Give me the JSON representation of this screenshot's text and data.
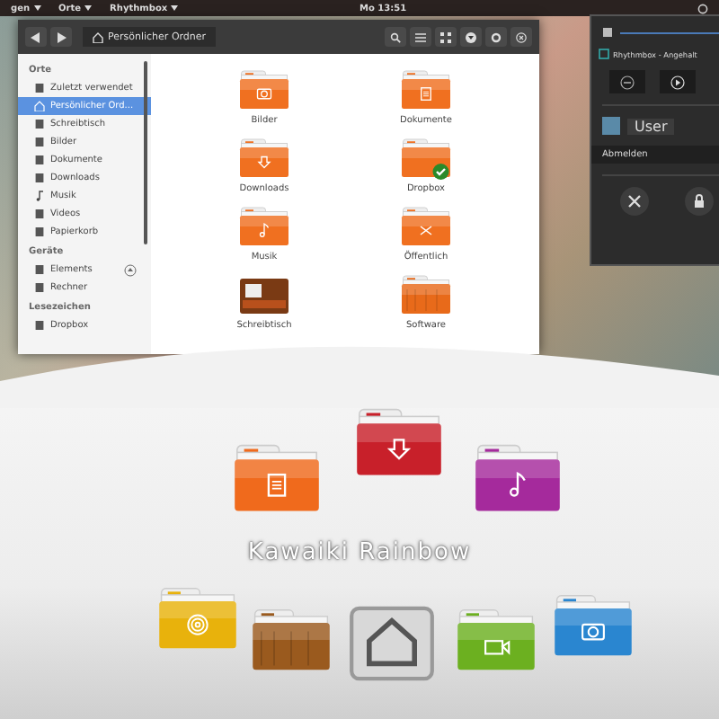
{
  "top_panel": {
    "menus": [
      "gen",
      "Orte",
      "Rhythmbox"
    ],
    "clock": "Mo 13:51"
  },
  "file_manager": {
    "path": "Persönlicher Ordner",
    "sidebar": [
      {
        "title": "Orte",
        "items": [
          {
            "label": "Zuletzt verwendet",
            "kind": "recent",
            "selected": false
          },
          {
            "label": "Persönlicher Ord...",
            "kind": "home",
            "selected": true
          },
          {
            "label": "Schreibtisch",
            "kind": "desktop",
            "selected": false
          },
          {
            "label": "Bilder",
            "kind": "pictures",
            "selected": false
          },
          {
            "label": "Dokumente",
            "kind": "documents",
            "selected": false
          },
          {
            "label": "Downloads",
            "kind": "downloads",
            "selected": false
          },
          {
            "label": "Musik",
            "kind": "music",
            "selected": false
          },
          {
            "label": "Videos",
            "kind": "videos",
            "selected": false
          },
          {
            "label": "Papierkorb",
            "kind": "trash",
            "selected": false
          }
        ]
      },
      {
        "title": "Geräte",
        "items": [
          {
            "label": "Elements",
            "kind": "drive",
            "selected": false,
            "ejectable": true
          },
          {
            "label": "Rechner",
            "kind": "computer",
            "selected": false,
            "ejectable": false
          }
        ]
      },
      {
        "title": "Lesezeichen",
        "items": [
          {
            "label": "Dropbox",
            "kind": "folder",
            "selected": false
          }
        ]
      }
    ],
    "files": [
      {
        "name": "Bilder",
        "kind": "pictures"
      },
      {
        "name": "Dokumente",
        "kind": "documents"
      },
      {
        "name": "Downloads",
        "kind": "downloads"
      },
      {
        "name": "Dropbox",
        "kind": "dropbox"
      },
      {
        "name": "Musik",
        "kind": "music"
      },
      {
        "name": "Öffentlich",
        "kind": "public"
      },
      {
        "name": "Schreibtisch",
        "kind": "desktop"
      },
      {
        "name": "Software",
        "kind": "software"
      }
    ]
  },
  "system_menu": {
    "volume": {
      "level": 1
    },
    "player": "Rhythmbox - Angehalt",
    "user": "User",
    "logout": "Abmelden"
  },
  "showcase": {
    "title": "Kawaiki Rainbow",
    "top_icons": [
      {
        "kind": "documents",
        "color": "#f06a1c"
      },
      {
        "kind": "downloads",
        "color": "#c8202a"
      },
      {
        "kind": "music",
        "color": "#a52a9c"
      }
    ],
    "bottom_icons": [
      {
        "kind": "spiral",
        "color": "#e8b20c"
      },
      {
        "kind": "wood",
        "color": "#9a5a1e"
      },
      {
        "kind": "home",
        "color": "#d8d8d8"
      },
      {
        "kind": "video",
        "color": "#6cb020"
      },
      {
        "kind": "camera",
        "color": "#2a86d0"
      }
    ]
  }
}
